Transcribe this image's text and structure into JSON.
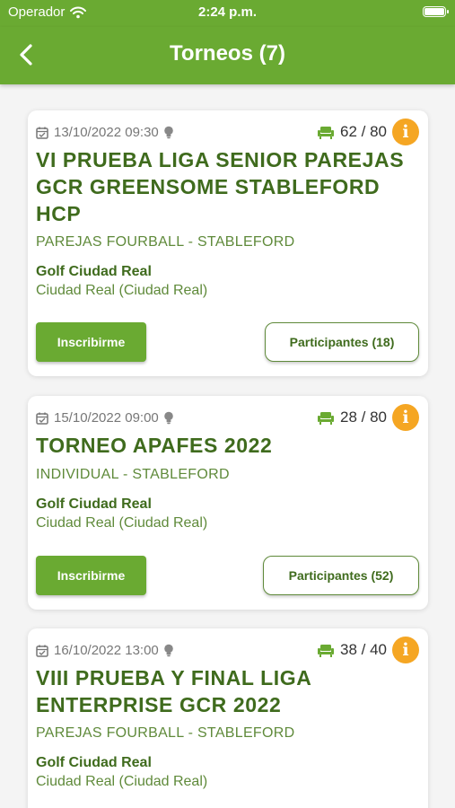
{
  "status_bar": {
    "carrier": "Operador",
    "time": "2:24 p.m."
  },
  "nav": {
    "title": "Torneos (7)"
  },
  "tournaments": [
    {
      "datetime": "13/10/2022 09:30",
      "seats": "62 / 80",
      "title_lines": [
        "VI PRUEBA LIGA SENIOR PAREJAS",
        "GCR GREENSOME STABLEFORD",
        "HCP"
      ],
      "mode": "PAREJAS FOURBALL - STABLEFORD",
      "club": "Golf Ciudad Real",
      "location": "Ciudad Real (Ciudad Real)",
      "signup_label": "Inscribirme",
      "participants_label": "Participantes (18)"
    },
    {
      "datetime": "15/10/2022 09:00",
      "seats": "28 / 80",
      "title_lines": [
        "TORNEO APAFES 2022"
      ],
      "mode": "INDIVIDUAL - STABLEFORD",
      "club": "Golf Ciudad Real",
      "location": "Ciudad Real (Ciudad Real)",
      "signup_label": "Inscribirme",
      "participants_label": "Participantes (52)"
    },
    {
      "datetime": "16/10/2022 13:00",
      "seats": "38 / 40",
      "title_lines": [
        "VIII PRUEBA Y FINAL LIGA",
        "ENTERPRISE GCR 2022"
      ],
      "mode": "PAREJAS FOURBALL - STABLEFORD",
      "club": "Golf Ciudad Real",
      "location": "Ciudad Real (Ciudad Real)"
    }
  ],
  "colors": {
    "brand_green": "#6aaa32",
    "title_green": "#3f6b1d",
    "info_orange": "#f5a623"
  },
  "icons": {
    "back": "chevron-left-icon",
    "date": "calendar-icon",
    "note": "bulb-icon",
    "seats": "seat-icon",
    "info": "info-icon"
  }
}
